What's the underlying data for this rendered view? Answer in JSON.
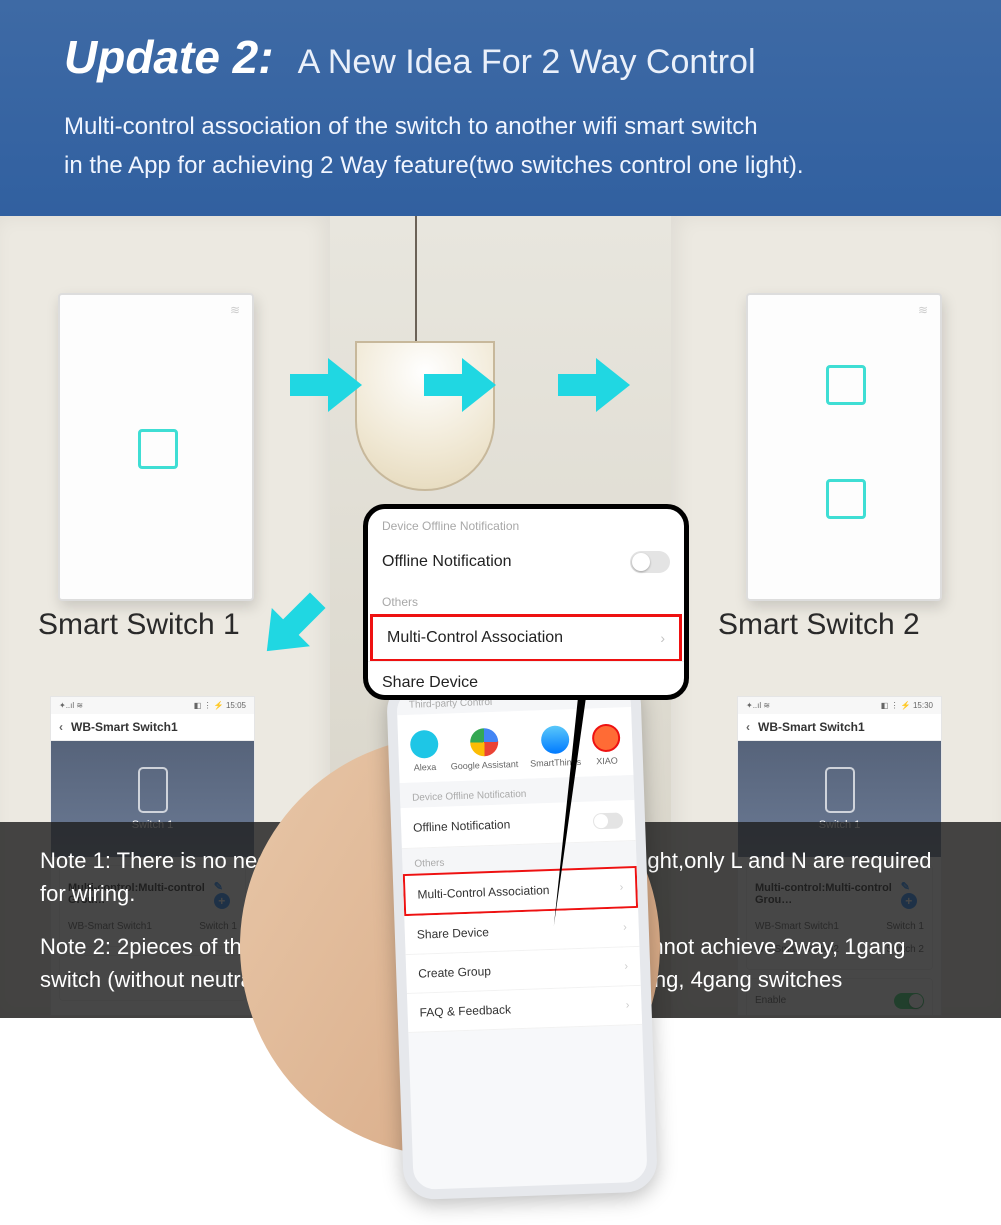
{
  "header": {
    "title": "Update 2:",
    "subtitle": "A New Idea For 2 Way Control",
    "desc_line1": "Multi-control association of the switch to another wifi smart switch",
    "desc_line2": "in the App for achieving 2 Way feature(two switches control one light)."
  },
  "switch_labels": {
    "left": "Smart Switch 1",
    "right": "Smart Switch 2"
  },
  "popup": {
    "section_notification": "Device Offline Notification",
    "offline": "Offline Notification",
    "section_others": "Others",
    "multi": "Multi-Control Association",
    "share": "Share Device"
  },
  "phone": {
    "third_party": "Third-party Control",
    "assistants": [
      "Alexa",
      "Google Assistant",
      "SmartThings",
      "XIAO"
    ],
    "section_notification": "Device Offline Notification",
    "offline": "Offline Notification",
    "section_others": "Others",
    "multi": "Multi-Control Association",
    "share": "Share Device",
    "create_group": "Create Group",
    "faq": "FAQ & Feedback"
  },
  "app_left": {
    "status_left": "✦..ıl ≋",
    "status_right": "◧ ⋮ ⚡ 15:05",
    "title": "WB-Smart Switch1",
    "device_name": "Switch 1",
    "group_title": "Multi-control:Multi-control Grou…",
    "rows": [
      {
        "device": "WB-Smart Switch1",
        "slot": "Switch 1"
      }
    ],
    "enable": "Enable",
    "enabled": false
  },
  "app_right": {
    "status_left": "✦..ıl ≋",
    "status_right": "◧ ⋮ ⚡ 15:30",
    "title": "WB-Smart Switch1",
    "device_name": "Switch 1",
    "group_title": "Multi-control:Multi-control Grou…",
    "rows": [
      {
        "device": "WB-Smart Switch1",
        "slot": "Switch 1"
      },
      {
        "device": "WB-Smart Switch2",
        "slot": "Switch 2"
      }
    ],
    "enable": "Enable",
    "enabled": true
  },
  "notes": {
    "n1": "Note 1: There is no need to wire the new added switch to the light,only L and N are required for wiring.",
    "n2": "Note 2: 2pieces of the 1gang switches (without neutral wire) cannot achieve 2way, 1gang switch (without neutral wire) can achieve 2way with 2gang, 3gang, 4gang switches"
  }
}
